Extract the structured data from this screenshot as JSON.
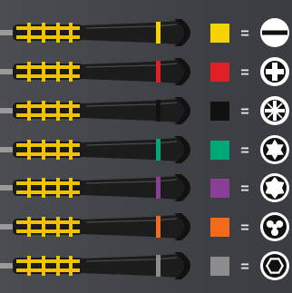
{
  "legend": {
    "equals_sign": "=",
    "rows": [
      {
        "color": "#f5d300",
        "icon": "slotted-tip-icon",
        "tool": "slotted-screwdriver"
      },
      {
        "color": "#e21e26",
        "icon": "phillips-tip-icon",
        "tool": "phillips-screwdriver"
      },
      {
        "color": "#111111",
        "icon": "pozidriv-tip-icon",
        "tool": "pozidriv-screwdriver"
      },
      {
        "color": "#00a878",
        "icon": "torx-tip-icon",
        "tool": "torx-screwdriver"
      },
      {
        "color": "#8a3f97",
        "icon": "torx-plus-tip-icon",
        "tool": "torx-plus-screwdriver"
      },
      {
        "color": "#f26b1d",
        "icon": "tri-wing-tip-icon",
        "tool": "tri-wing-screwdriver"
      },
      {
        "color": "#8c8c8c",
        "icon": "hex-tip-icon",
        "tool": "hex-screwdriver"
      }
    ]
  }
}
